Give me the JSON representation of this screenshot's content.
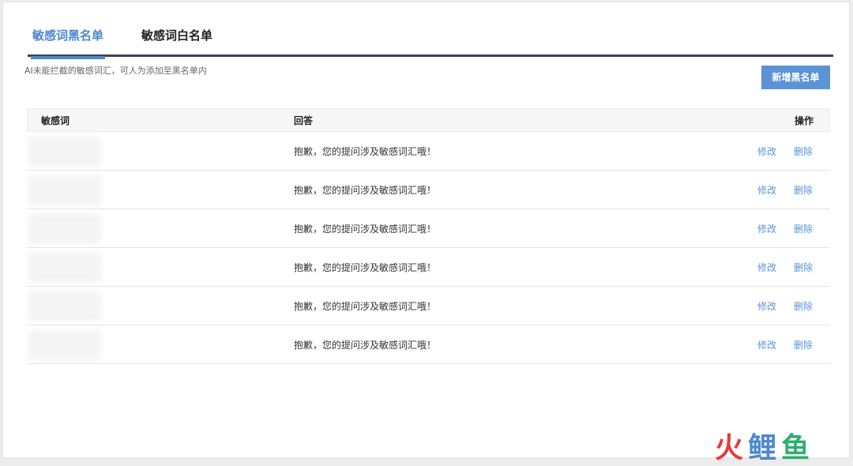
{
  "tabs": [
    {
      "label": "敏感词黑名单",
      "active": true
    },
    {
      "label": "敏感词白名单",
      "active": false
    }
  ],
  "hint": "AI未能拦截的敏感词汇，可人为添加至黑名单内",
  "add_button": "新增黑名单",
  "table": {
    "headers": {
      "word": "敏感词",
      "answer": "回答",
      "actions": "操作"
    },
    "rows": [
      {
        "word": "",
        "answer": "抱歉，您的提问涉及敏感词汇哦！",
        "edit": "修改",
        "delete": "删除"
      },
      {
        "word": "",
        "answer": "抱歉，您的提问涉及敏感词汇哦！",
        "edit": "修改",
        "delete": "删除"
      },
      {
        "word": "",
        "answer": "抱歉，您的提问涉及敏感词汇哦！",
        "edit": "修改",
        "delete": "删除"
      },
      {
        "word": "",
        "answer": "抱歉，您的提问涉及敏感词汇哦！",
        "edit": "修改",
        "delete": "删除"
      },
      {
        "word": "",
        "answer": "抱歉，您的提问涉及敏感词汇哦！",
        "edit": "修改",
        "delete": "删除"
      },
      {
        "word": "",
        "answer": "抱歉，您的提问涉及敏感词汇哦！",
        "edit": "修改",
        "delete": "删除"
      }
    ]
  },
  "watermark": {
    "chars": [
      "火",
      "鲤",
      "鱼"
    ],
    "colors": [
      "#e83a3a",
      "#4d88cc",
      "#2fae72"
    ]
  },
  "colors": {
    "accent": "#4d88cc",
    "button": "#5b93d6",
    "tab_underline": "#3a4350"
  }
}
